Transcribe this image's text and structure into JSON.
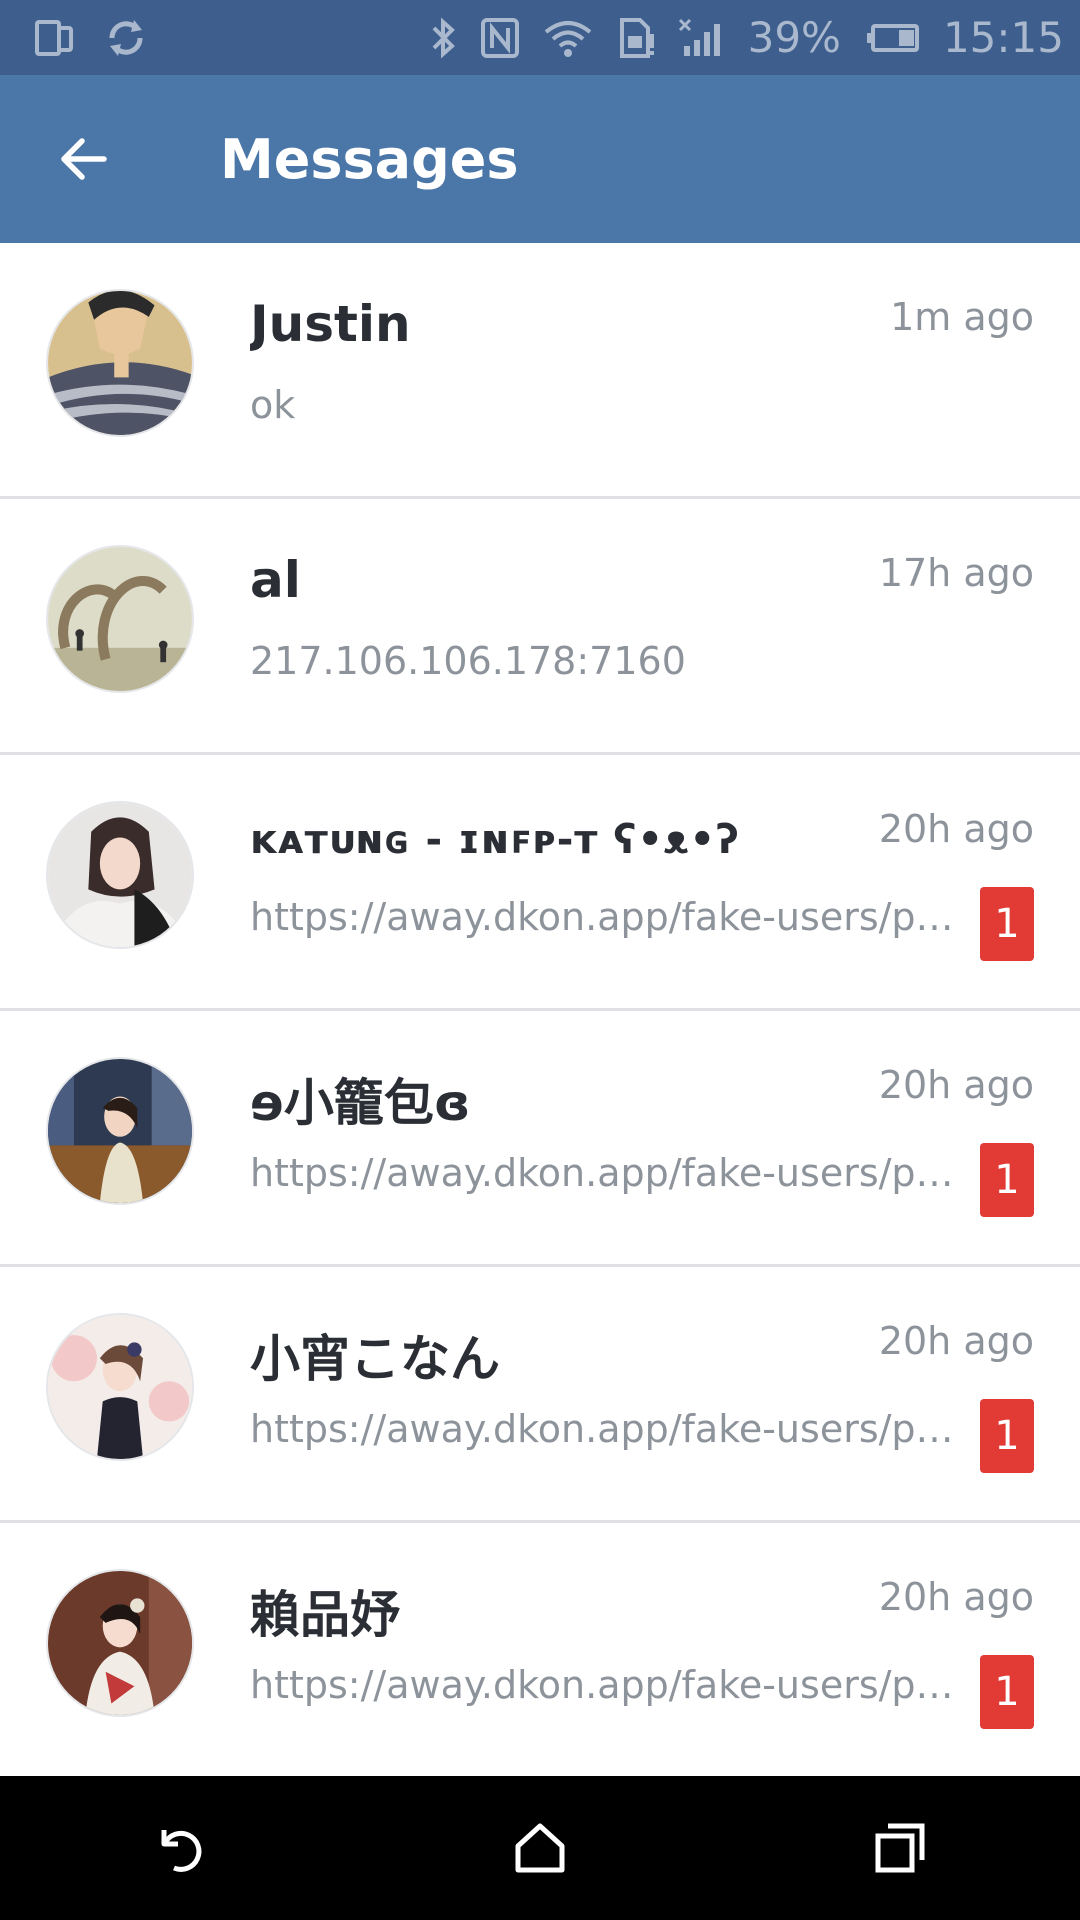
{
  "status_bar": {
    "battery": "39%",
    "time": "15:15"
  },
  "app_bar": {
    "title": "Messages"
  },
  "conversations": [
    {
      "name": "Justin",
      "time": "1m ago",
      "preview": "ok",
      "unread": ""
    },
    {
      "name": "al",
      "time": "17h ago",
      "preview": "217.106.106.178:7160",
      "unread": ""
    },
    {
      "name": "ᴋᴀᴛᴜɴɢ - ɪɴꜰᴘ-ᴛ ʕ•ᴥ•ʔ",
      "time": "20h ago",
      "preview": "https://away.dkon.app/fake-users/po...",
      "unread": "1"
    },
    {
      "name": "ɘ小籠包ɞ",
      "time": "20h ago",
      "preview": "https://away.dkon.app/fake-users/po...",
      "unread": "1"
    },
    {
      "name": "小宵こなん",
      "time": "20h ago",
      "preview": "https://away.dkon.app/fake-users/po...",
      "unread": "1"
    },
    {
      "name": "賴品妤",
      "time": "20h ago",
      "preview": "https://away.dkon.app/fake-users/po...",
      "unread": "1"
    }
  ],
  "colors": {
    "status_bar": "#3e5f8e",
    "app_bar": "#4a76a8",
    "badge": "#e23a34"
  },
  "icons": {
    "back": "arrow-left-icon",
    "nav_back": "nav-back-icon",
    "nav_home": "nav-home-icon",
    "nav_recents": "nav-recents-icon"
  }
}
